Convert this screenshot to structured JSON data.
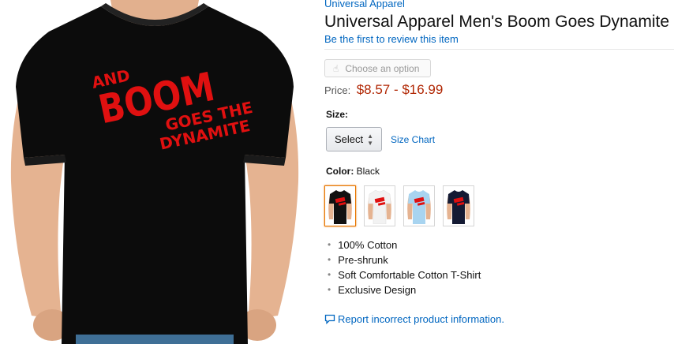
{
  "product": {
    "brand": "Universal Apparel",
    "title": "Universal Apparel Men's Boom Goes Dynamite",
    "review_link": "Be the first to review this item",
    "image_icon": "t-shirt-photo"
  },
  "option_button": {
    "label": "Choose an option",
    "icon": "pointer-hand-icon"
  },
  "price": {
    "label": "Price:",
    "value": "$8.57 - $16.99"
  },
  "size": {
    "label": "Size:",
    "selected": "Select",
    "chart_link": "Size Chart"
  },
  "color": {
    "label": "Color:",
    "value": "Black",
    "swatches": [
      {
        "name": "Black",
        "hex": "#111111",
        "selected": true
      },
      {
        "name": "White",
        "hex": "#f2f2f2",
        "selected": false
      },
      {
        "name": "Light Blue",
        "hex": "#a8d4f0",
        "selected": false
      },
      {
        "name": "Navy",
        "hex": "#141a33",
        "selected": false
      }
    ]
  },
  "features": [
    "100% Cotton",
    "Pre-shrunk",
    "Soft Comfortable Cotton T-Shirt",
    "Exclusive Design"
  ],
  "report": {
    "label": "Report incorrect product information.",
    "icon": "chat-bubble-icon"
  },
  "shirt_graphic": {
    "line1": "AND",
    "line2": "BOOM",
    "line3": "GOES THE",
    "line4": "DYNAMITE"
  },
  "colors": {
    "link": "#0066c0",
    "price": "#b12704",
    "graphic_red": "#e01010",
    "selected_border": "#e77600"
  }
}
